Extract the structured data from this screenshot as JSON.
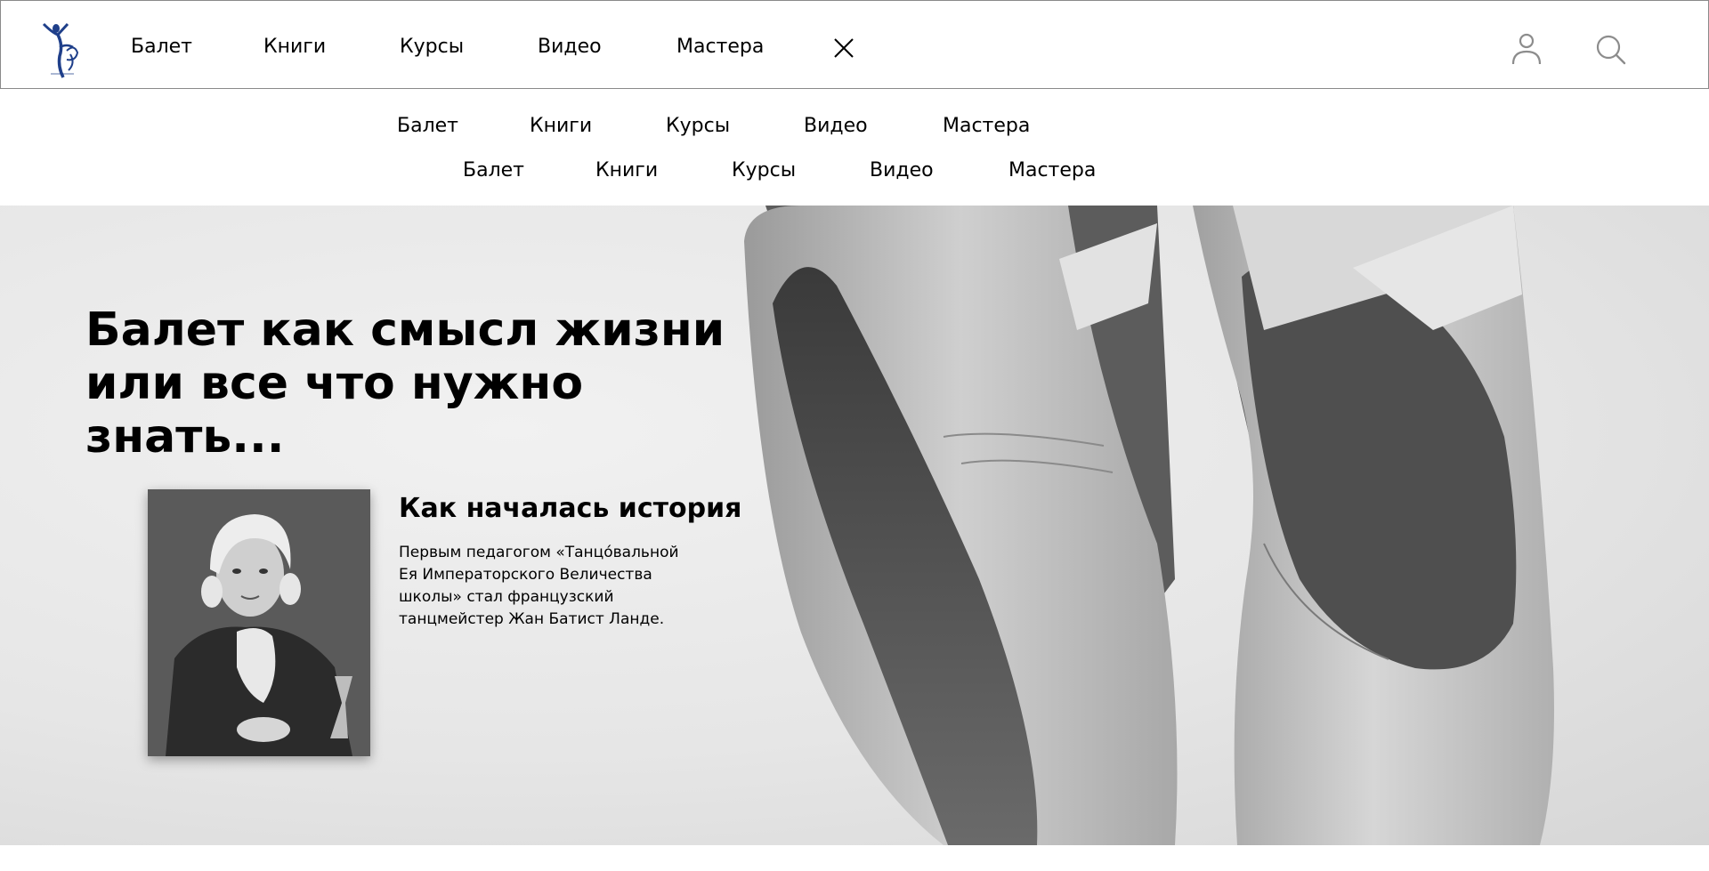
{
  "header": {
    "logo_icon": "ballet-dancer-logo-icon",
    "nav": [
      "Балет",
      "Книги",
      "Курсы",
      "Видео",
      "Мастера"
    ],
    "close_icon": "close-icon",
    "user_icon": "user-icon",
    "search_icon": "search-icon"
  },
  "subnav": {
    "row1": [
      "Балет",
      "Книги",
      "Курсы",
      "Видео",
      "Мастера"
    ],
    "row2": [
      "Балет",
      "Книги",
      "Курсы",
      "Видео",
      "Мастера"
    ]
  },
  "hero": {
    "title": "Балет как смысл жизни\nили все что нужно знать...",
    "photo": "pointe-shoes-photo",
    "story": {
      "portrait": "portrait-image",
      "title": "Как началась история",
      "text": "Первым педагогом «Танцо́вальной Ея Императорского Величества школы» стал французский танцмейстер Жан Батист Ланде."
    }
  },
  "colors": {
    "text": "#000000",
    "logo": "#1f3f8a",
    "hero_bg": "#e6e6e6",
    "border": "#8a8a8a"
  }
}
